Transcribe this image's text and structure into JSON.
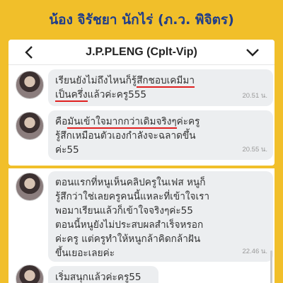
{
  "banner": {
    "title": "น้อง จิรัชยา นักไร่ (ภ.ว. พิจิตร)"
  },
  "chat": {
    "title": "J.P.PLENG (Cplt-Vip)"
  },
  "messages": [
    {
      "pre": "เรียนยังไม่ถึงไหนก็รู้",
      "hl1": "สึกชอบเคมีมา",
      "hl2": "เป็นครึ่ง",
      "post": "แล้วค่ะครู555",
      "time": "20.51 น."
    },
    {
      "pre": "คือ",
      "hl": "มันเข้าใจมากกว่าเดิมจริงๆ",
      "post": "ค่ะครู",
      "line2": "รู้สึกเหมือนตัวเองกำลังจะฉลาดขึ้น",
      "line3": "ค่ะ55",
      "time": "20.55 น."
    },
    {
      "lines": [
        "ตอนแรกที่หนูเห็นคลิปครูในเฟส หนูก็",
        "รู้สึกว่าใช่เลยครูคนนี้แหละที่เข้าใจเรา",
        "พอมาเรียนแล้วก็เข้าใจจริงๆค่ะ55",
        "ตอนนี้หนูยังไม่ประสบผลสำเร็จหรอก",
        "ค่ะครู แต่ครูทำให้หนูกล้าคิดกล้าฝัน",
        "ขึ้นเยอะเลยค่ะ"
      ],
      "time": "22.46 น."
    },
    {
      "text": "เริ่มสนุกแล้วค่ะครู55"
    }
  ],
  "colors": {
    "background": "#f1bf2a",
    "banner_text": "#1f3d8a",
    "underline": "#e02020",
    "bubble": "#eceef0"
  }
}
